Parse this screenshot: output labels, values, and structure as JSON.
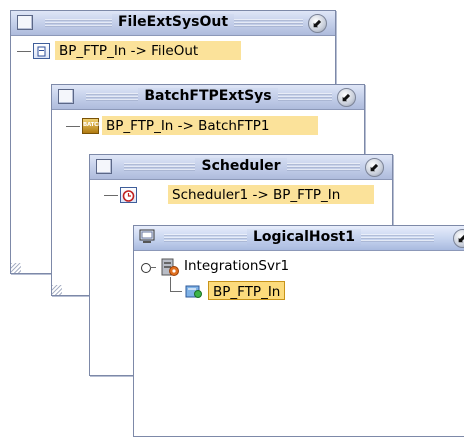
{
  "windows": {
    "fileext": {
      "title": "FileExtSysOut",
      "node_label": "BP_FTP_In -> FileOut"
    },
    "batch": {
      "title": "BatchFTPExtSys",
      "node_label": "BP_FTP_In -> BatchFTP1",
      "icon_text": "BATCH"
    },
    "scheduler": {
      "title": "Scheduler",
      "node_label": "Scheduler1 -> BP_FTP_In"
    },
    "logicalhost": {
      "title": "LogicalHost1",
      "server_label": "IntegrationSvr1",
      "project_label": "BP_FTP_In"
    }
  },
  "icons": {
    "system_menu": "window-menu-icon",
    "minimize": "collapse-arrow-icon",
    "host": "monitor-icon",
    "server": "integration-server-icon",
    "project": "deployed-project-icon",
    "scheduler": "clock-icon",
    "file": "file-icon",
    "batch": "batch-ftp-icon"
  },
  "colors": {
    "label_highlight": "#fbe29a",
    "titlebar": "#c5d0ea",
    "selected_border": "#c8941a"
  }
}
